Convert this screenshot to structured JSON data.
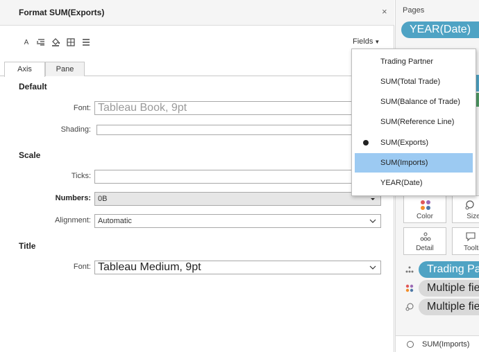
{
  "format_pane": {
    "title": "Format SUM(Exports)",
    "close": "×",
    "toolbar": {
      "icons": [
        "font-icon",
        "align-icon",
        "shading-icon",
        "borders-icon",
        "lines-icon"
      ],
      "font_glyph": "A",
      "fields_label": "Fields",
      "fields_arrow": "▼"
    },
    "tabs": [
      "Axis",
      "Pane"
    ],
    "sections": {
      "default": {
        "title": "Default",
        "font_label": "Font:",
        "font_value": "Tableau Book, 9pt",
        "shading_label": "Shading:"
      },
      "scale": {
        "title": "Scale",
        "ticks_label": "Ticks:",
        "numbers_label": "Numbers:",
        "numbers_value": "0B",
        "alignment_label": "Alignment:",
        "alignment_value": "Automatic"
      },
      "title_section": {
        "title": "Title",
        "font_label": "Font:",
        "font_value": "Tableau Medium, 9pt"
      }
    }
  },
  "fields_dropdown": {
    "items": [
      {
        "label": "Trading Partner",
        "selected": false,
        "highlighted": false
      },
      {
        "label": "SUM(Total Trade)",
        "selected": false,
        "highlighted": false
      },
      {
        "label": "SUM(Balance of Trade)",
        "selected": false,
        "highlighted": false
      },
      {
        "label": "SUM(Reference Line)",
        "selected": false,
        "highlighted": false
      },
      {
        "label": "SUM(Exports)",
        "selected": true,
        "highlighted": false
      },
      {
        "label": "SUM(Imports)",
        "selected": false,
        "highlighted": true
      },
      {
        "label": "YEAR(Date)",
        "selected": false,
        "highlighted": false
      }
    ]
  },
  "right_panel": {
    "pages_label": "Pages",
    "pages_pill": "YEAR(Date)",
    "marks": {
      "color": "Color",
      "size": "Size",
      "detail": "Detail",
      "tooltip": "Tooltip"
    },
    "mark_pills": [
      "Trading Partner",
      "Multiple fields",
      "Multiple fields"
    ],
    "bottom_item": "SUM(Imports)"
  },
  "colors": {
    "pill_blue": "#4fa3c4",
    "highlight": "#9ccaf2",
    "header_bg": "#f5f5f5"
  }
}
